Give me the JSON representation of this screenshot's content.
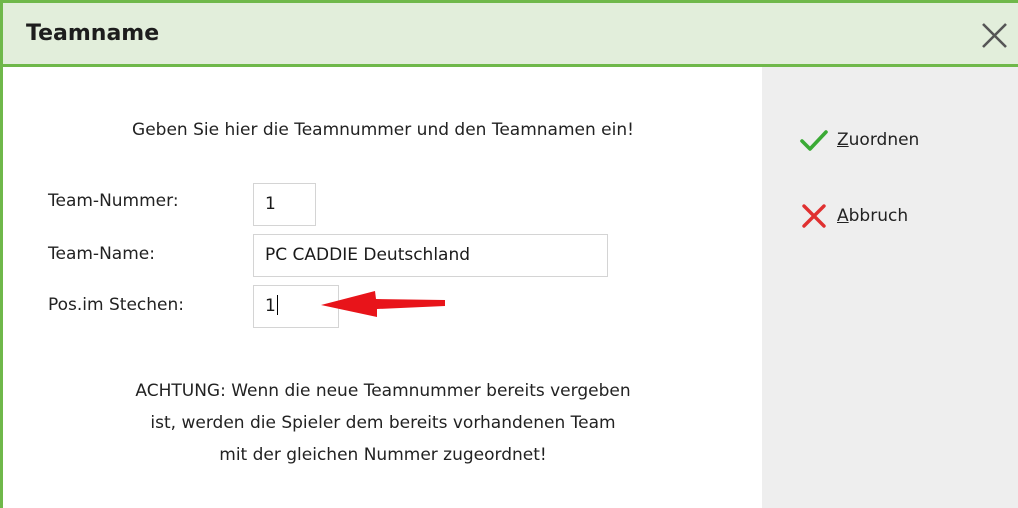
{
  "dialog": {
    "title": "Teamname",
    "intro": "Geben Sie hier die Teamnummer und den Teamnamen ein!",
    "fields": {
      "team_number_label": "Team-Nummer:",
      "team_number_value": "1",
      "team_name_label": "Team-Name:",
      "team_name_value": "PC CADDIE Deutschland",
      "tiebreak_label": "Pos.im Stechen:",
      "tiebreak_value": "1"
    },
    "warning": {
      "line1": "ACHTUNG: Wenn die neue Teamnummer bereits vergeben",
      "line2": "ist, werden die Spieler dem bereits vorhandenen Team",
      "line3": "mit der gleichen Nummer zugeordnet!"
    }
  },
  "actions": {
    "assign_mnemonic": "Z",
    "assign_rest": "uordnen",
    "cancel_mnemonic": "A",
    "cancel_rest": "bbruch"
  },
  "icons": {
    "close": "close-icon",
    "check": "checkmark-icon",
    "cancel": "cross-icon",
    "annotation": "red-arrow-icon"
  },
  "colors": {
    "accent_border": "#6fb84a",
    "titlebar_bg": "#e2eedb",
    "check_green": "#3aaa35",
    "cancel_red": "#e03030",
    "arrow_red": "#e8141a"
  }
}
